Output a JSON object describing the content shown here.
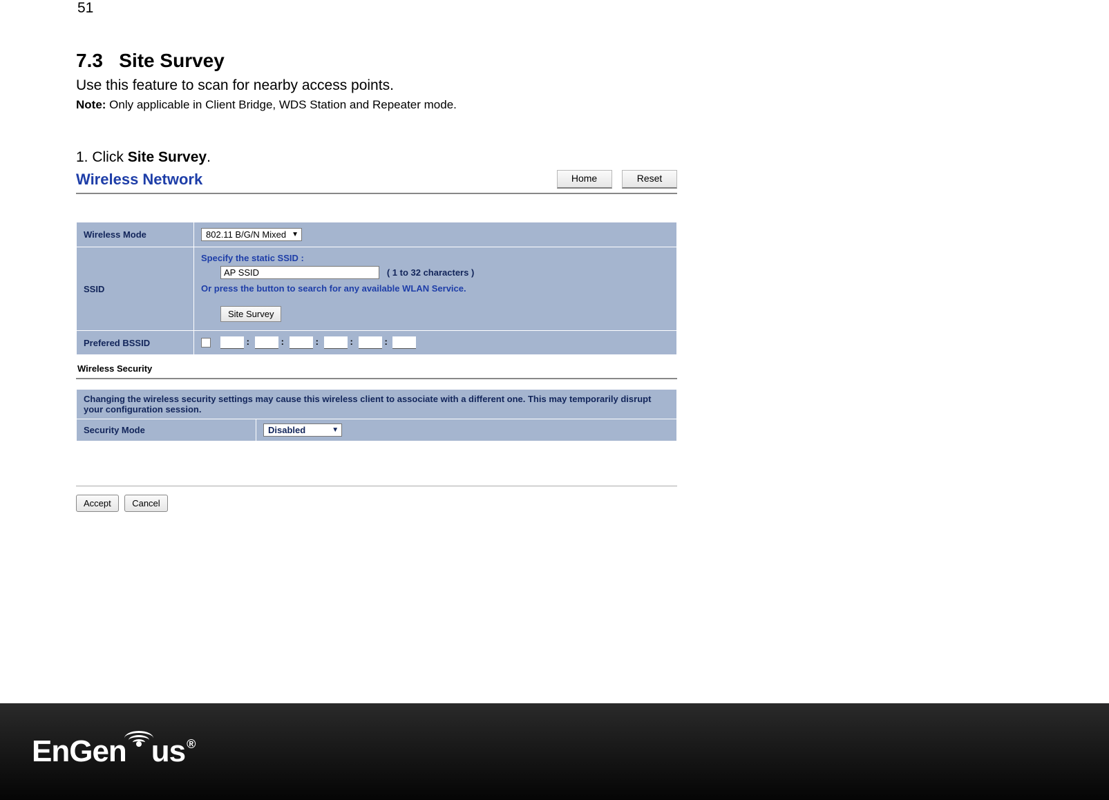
{
  "page_number": "51",
  "section": {
    "number": "7.3",
    "title": "Site Survey",
    "description": "Use this feature to scan for nearby access points.",
    "note_label": "Note:",
    "note_text": " Only applicable in Client Bridge, WDS Station and Repeater mode."
  },
  "step": {
    "prefix": "1. Click ",
    "bold": "Site Survey",
    "suffix": "."
  },
  "ui": {
    "heading": "Wireless Network",
    "top_buttons": {
      "home": "Home",
      "reset": "Reset"
    },
    "rows": {
      "wireless_mode": {
        "label": "Wireless Mode",
        "value": "802.11 B/G/N Mixed"
      },
      "ssid": {
        "label": "SSID",
        "specify": "Specify the static SSID  :",
        "input_value": "AP SSID",
        "chars_hint": "( 1 to 32 characters )",
        "or_press": "Or press the button to search for any available WLAN Service.",
        "site_survey_btn": "Site Survey"
      },
      "bssid": {
        "label": "Prefered BSSID"
      }
    },
    "security": {
      "sub_heading": "Wireless Security",
      "warning": "Changing the wireless security settings may cause this wireless client to associate with a different one. This may temporarily disrupt your configuration session.",
      "mode_label": "Security Mode",
      "mode_value": "Disabled"
    },
    "actions": {
      "accept": "Accept",
      "cancel": "Cancel"
    }
  },
  "footer": {
    "brand": "EnGenius",
    "reg": "®"
  }
}
